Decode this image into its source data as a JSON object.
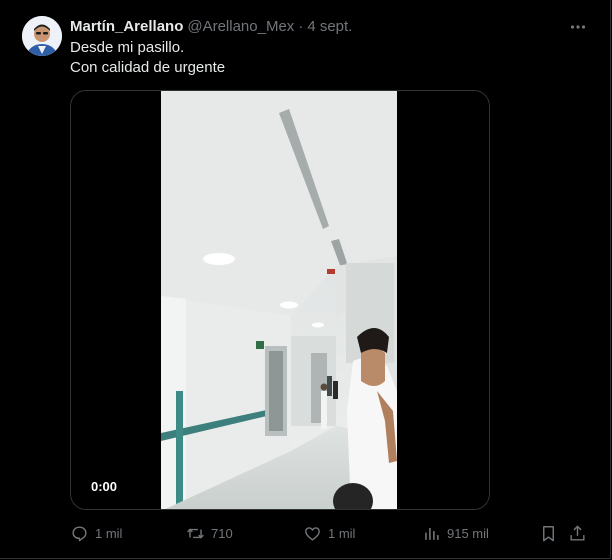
{
  "tweet": {
    "author_name": "Martín_Arellano",
    "handle": "@Arellano_Mex",
    "separator": "·",
    "date": "4 sept.",
    "text_lines": [
      "Desde mi pasillo.",
      "Con calidad de urgente"
    ],
    "more_icon": "more-horizontal-icon",
    "avatar_icon": "profile-photo"
  },
  "video": {
    "timestamp": "0:00",
    "content": "hospital-corridor-video"
  },
  "actions": {
    "replies": "1 mil",
    "reposts": "710",
    "likes": "1 mil",
    "views": "915 mil",
    "reply_icon": "reply-icon",
    "repost_icon": "repost-icon",
    "like_icon": "heart-icon",
    "views_icon": "views-chart-icon",
    "bookmark_icon": "bookmark-icon",
    "share_icon": "share-icon"
  },
  "colors": {
    "background": "#000000",
    "text": "#e7e9ea",
    "muted": "#71767b",
    "border": "#2f3336"
  }
}
